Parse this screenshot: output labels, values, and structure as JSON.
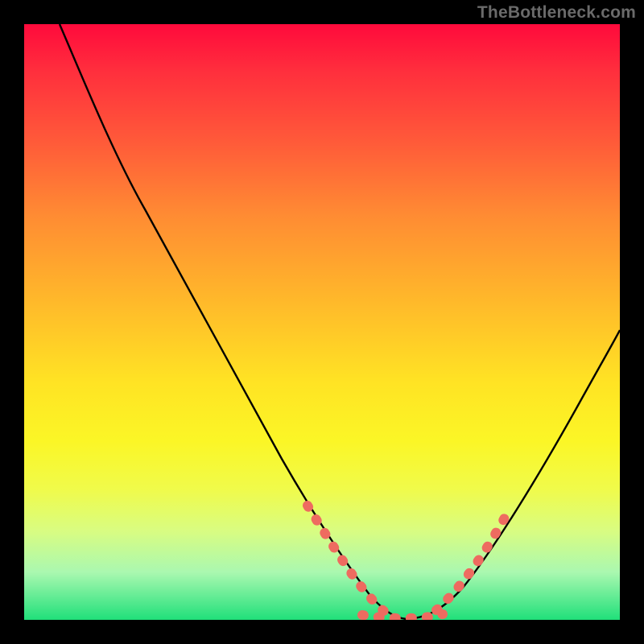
{
  "watermark": "TheBottleneck.com",
  "colors": {
    "frame": "#000000",
    "curve_stroke": "#000000",
    "highlight": "#ee6b60",
    "watermark_text": "#6a6a6a",
    "gradient_stops": [
      "#ff0a3c",
      "#ff2f3d",
      "#ff5b39",
      "#ff8b33",
      "#ffb42b",
      "#ffe324",
      "#fbf626",
      "#f0fb4a",
      "#d9fc81",
      "#aaf8b0",
      "#20e07a"
    ]
  },
  "chart_data": {
    "type": "line",
    "title": "",
    "xlabel": "",
    "ylabel": "",
    "xlim": [
      0,
      100
    ],
    "ylim": [
      0,
      100
    ],
    "grid": false,
    "series": [
      {
        "name": "left-curve",
        "x": [
          6,
          10,
          15,
          20,
          26,
          32,
          38,
          44,
          48,
          52,
          55,
          57,
          58,
          60,
          62,
          64
        ],
        "y": [
          100,
          93,
          84,
          75,
          65,
          54,
          43,
          32,
          24,
          16,
          10,
          7,
          5,
          3,
          2,
          1
        ]
      },
      {
        "name": "right-curve",
        "x": [
          64,
          67,
          70,
          74,
          78,
          82,
          86,
          90,
          94,
          98,
          100
        ],
        "y": [
          1,
          2,
          4,
          8,
          14,
          22,
          30,
          38,
          45,
          52,
          55
        ]
      }
    ],
    "highlight_segments": [
      {
        "on": "left-curve",
        "x_start": 48,
        "x_end": 56,
        "style": "thick-dotted"
      },
      {
        "on": "floor",
        "x_start": 56,
        "x_end": 70,
        "style": "thick-dotted"
      },
      {
        "on": "right-curve",
        "x_start": 70,
        "x_end": 79,
        "style": "thick-dotted"
      }
    ],
    "notes": "Background vertical gradient encodes a scalar field from red (top) through orange/yellow to green (bottom). The V-shaped curve appears to touch the bottom axis near x≈64. Values are estimated from pixels; chart has no tick labels."
  }
}
